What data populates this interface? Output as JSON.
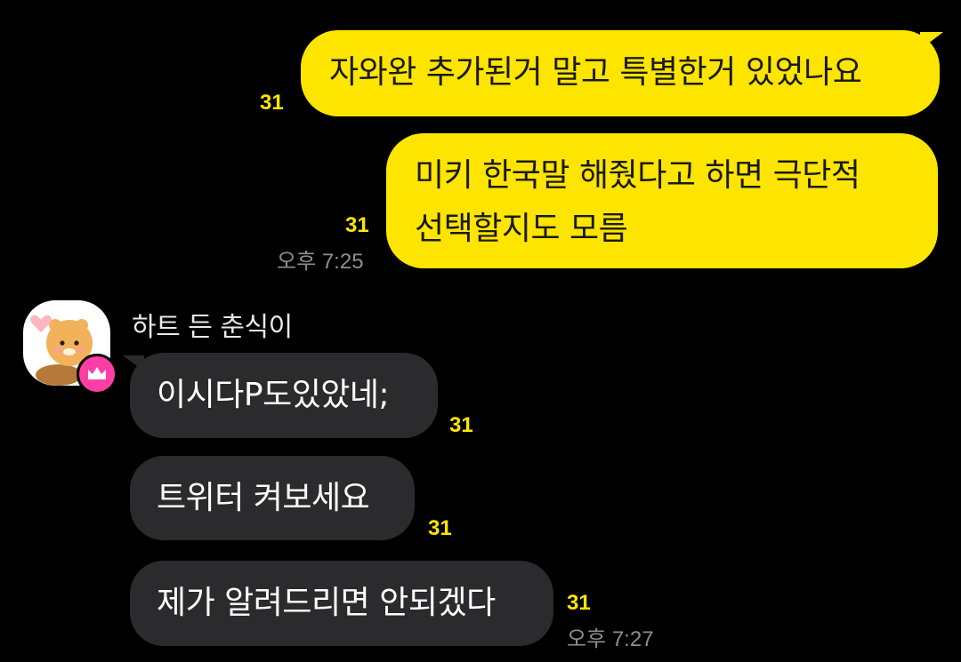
{
  "colors": {
    "background": "#000000",
    "my_bubble": "#FEE500",
    "their_bubble": "#2b2b2d",
    "unread_count": "#FEE500",
    "timestamp": "#8e8e8e",
    "badge": "#ff3ea5"
  },
  "messages_out": [
    {
      "text": "자와완 추가된거 말고 특별한거 있었나요",
      "unread": "31"
    },
    {
      "lines": [
        "미키 한국말 해줬다고 하면 극단적",
        "선택할지도 모름"
      ],
      "unread": "31",
      "time": "오후 7:25"
    }
  ],
  "incoming": {
    "sender": "하트 든 춘식이",
    "avatar_icon": "chunsik-heart-avatar",
    "badge_icon": "crown-icon",
    "messages": [
      {
        "text": "이시다P도있았네;",
        "unread": "31"
      },
      {
        "text": "트위터 켜보세요",
        "unread": "31"
      },
      {
        "text": "제가 알려드리면 안되겠다",
        "unread": "31",
        "time": "오후 7:27"
      }
    ]
  }
}
